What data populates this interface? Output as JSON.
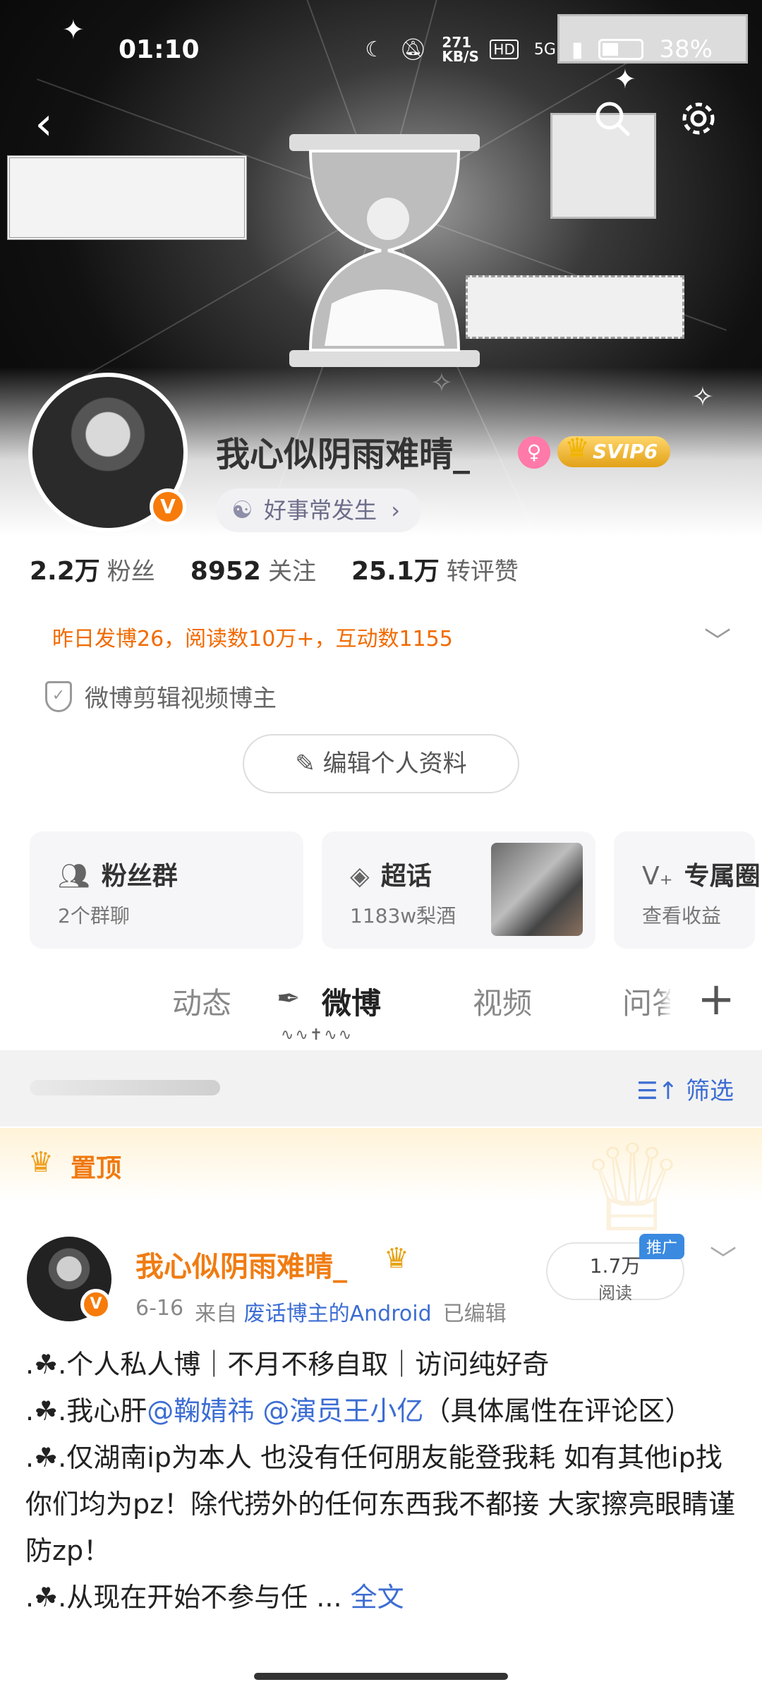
{
  "status_bar": {
    "time": "01:10",
    "net_speed": "271 KB/S",
    "hd": "HD",
    "network": "5G",
    "battery": "38%"
  },
  "header": {
    "back_icon": "back-arrow-icon",
    "search_icon": "search-icon",
    "settings_icon": "gear-icon"
  },
  "profile": {
    "name": "我心似阴雨难晴_",
    "vip_label": "SVIP6",
    "verified_mark": "V",
    "tagline": "好事常发生",
    "tagline_chevron": "›",
    "stats": [
      {
        "value": "2.2万",
        "label": "粉丝"
      },
      {
        "value": "8952",
        "label": "关注"
      },
      {
        "value": "25.1万",
        "label": "转评赞"
      }
    ],
    "summary": "昨日发博26，阅读数10万+，互动数1155",
    "certification": "微博剪辑视频博主",
    "edit_button": "编辑个人资料"
  },
  "cards": [
    {
      "title": "粉丝群",
      "subtitle": "2个群聊"
    },
    {
      "title": "超话",
      "subtitle": "1183w梨酒"
    },
    {
      "title": "专属圈",
      "subtitle": "查看收益"
    }
  ],
  "tabs": [
    {
      "label": "动态"
    },
    {
      "label": "微博"
    },
    {
      "label": "视频"
    },
    {
      "label": "问答"
    }
  ],
  "filter": {
    "label": "筛选"
  },
  "pinned": {
    "label": "置顶"
  },
  "post": {
    "author": "我心似阴雨难晴_",
    "date": "6-16",
    "source_prefix": "来自",
    "source": "废话博主的Android",
    "edited": "已编辑",
    "reads_value": "1.7万",
    "reads_label": "阅读",
    "promo": "推广",
    "lines": {
      "l1": ".☘.个人私人博｜不月不移自取｜访问纯好奇",
      "l2_a": ".☘.我心肝",
      "l2_m1": "@鞠婧祎",
      "l2_m2": "@演员王小亿",
      "l2_b": "（具体属性在评论区）",
      "l3": ".☘.仅湖南ip为本人 也没有任何朋友能登我耗 如有其他ip找你们均为pz！除代捞外的任何东西我不都接 大家擦亮眼睛谨防zp！",
      "l4": ".☘.从现在开始不参与任 ...",
      "more": "全文"
    }
  }
}
